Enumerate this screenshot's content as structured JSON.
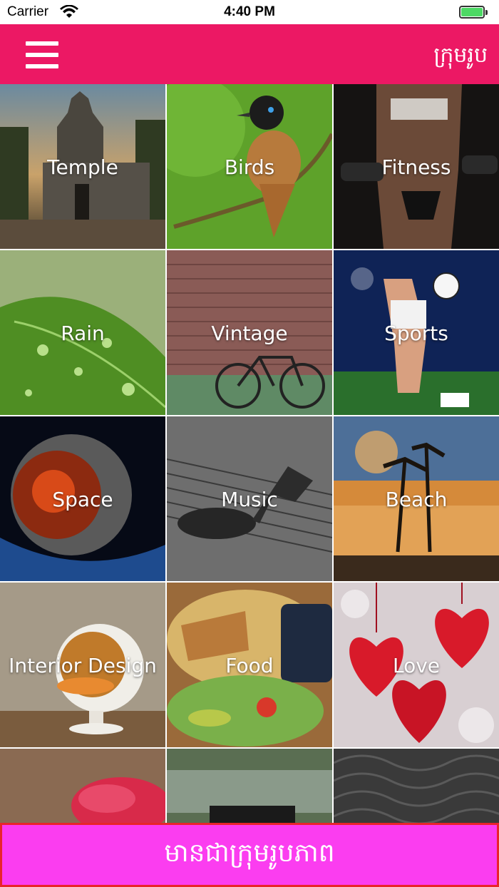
{
  "status_bar": {
    "carrier": "Carrier",
    "time": "4:40 PM",
    "wifi_icon": "wifi-icon",
    "battery_icon": "battery-icon",
    "battery_color": "#4cd964"
  },
  "header": {
    "title": "ក្រុមរូប",
    "menu_icon": "hamburger-menu-icon",
    "background": "#ec1864"
  },
  "categories": [
    {
      "label": "Temple"
    },
    {
      "label": "Birds"
    },
    {
      "label": "Fitness"
    },
    {
      "label": "Rain"
    },
    {
      "label": "Vintage"
    },
    {
      "label": "Sports"
    },
    {
      "label": "Space"
    },
    {
      "label": "Music"
    },
    {
      "label": "Beach"
    },
    {
      "label": "Interior Design"
    },
    {
      "label": "Food"
    },
    {
      "label": "Love"
    },
    {
      "label": ""
    },
    {
      "label": ""
    },
    {
      "label": ""
    }
  ],
  "bottom_button": {
    "label": "មានជាក្រុមរូបភាព",
    "background": "#fb3df0"
  }
}
